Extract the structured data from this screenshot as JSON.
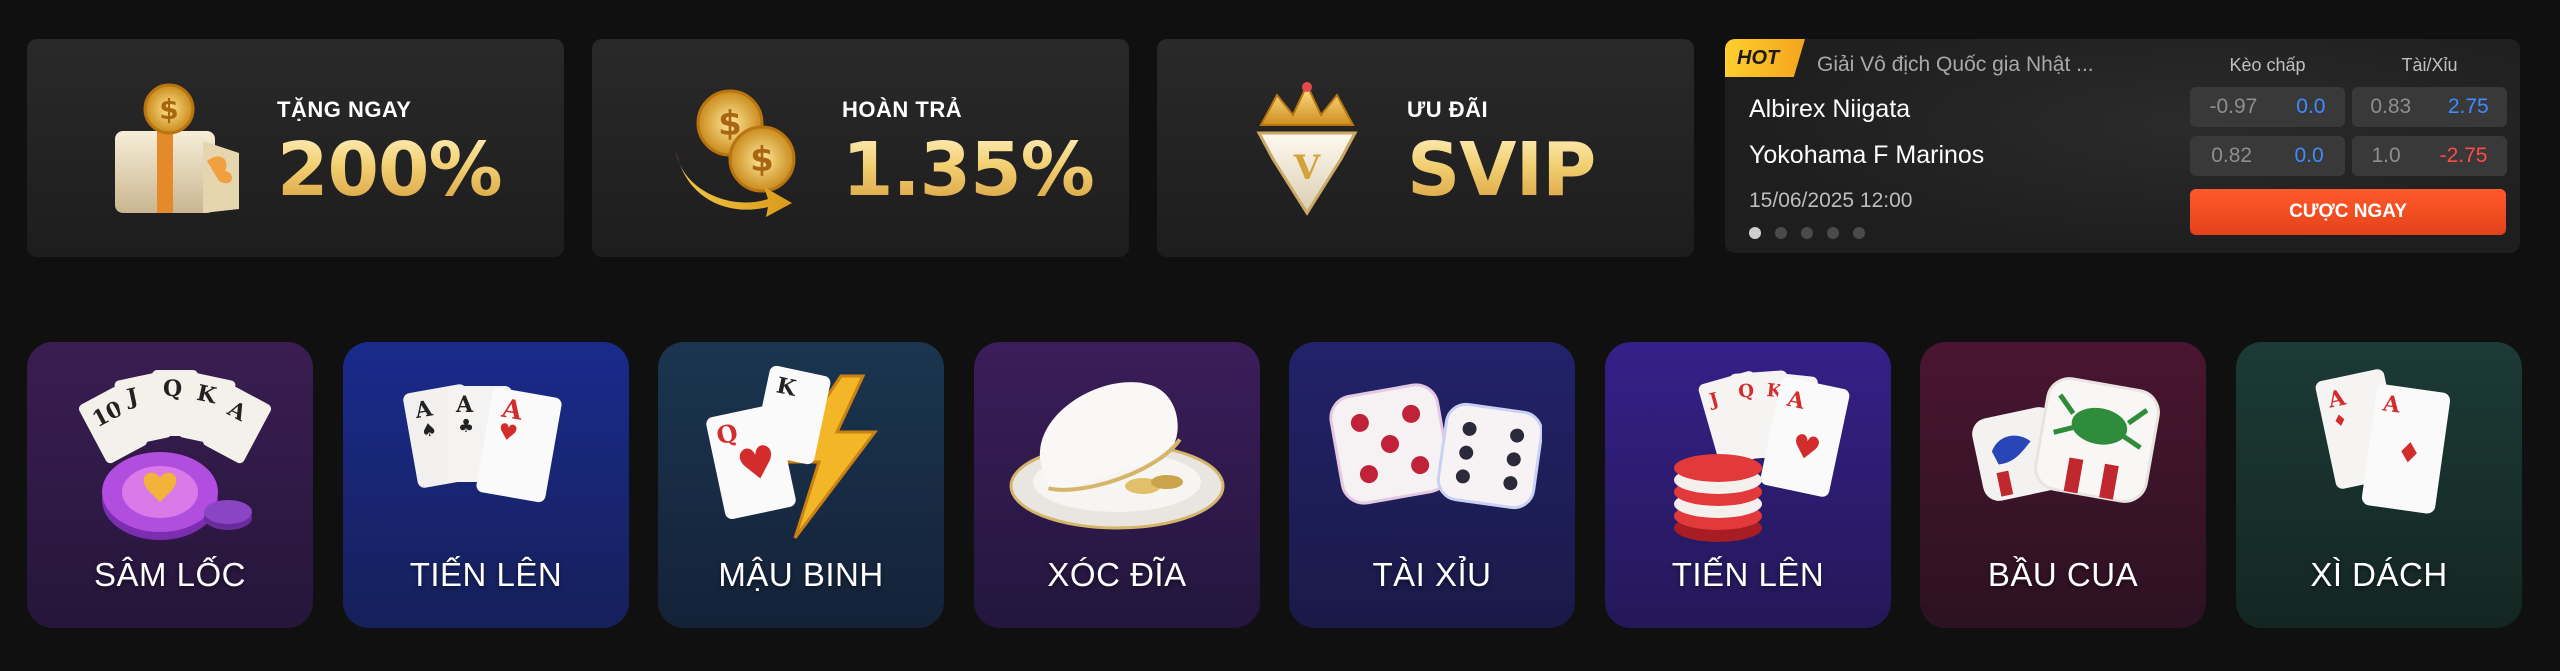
{
  "promos": [
    {
      "label": "TẶNG NGAY",
      "value": "200%"
    },
    {
      "label": "HOÀN TRẢ",
      "value": "1.35%"
    },
    {
      "label": "ƯU ĐÃI",
      "value": "SVIP"
    }
  ],
  "match": {
    "badge": "HOT",
    "league": "Giải Vô địch Quốc gia Nhật ...",
    "home": "Albirex Niigata",
    "away": "Yokohama F Marinos",
    "datetime": "15/06/2025 12:00",
    "handicap_header": "Kèo chấp",
    "overunder_header": "Tài/Xỉu",
    "odds": {
      "handicap_home": [
        "-0.97",
        "0.0"
      ],
      "handicap_away": [
        "0.82",
        "0.0"
      ],
      "ou_home": [
        "0.83",
        "2.75"
      ],
      "ou_away": [
        "1.0",
        "-2.75"
      ]
    },
    "bet_label": "CƯỢC NGAY",
    "carousel_count": 5,
    "carousel_active": 1
  },
  "games": [
    {
      "label": "SÂM LỐC",
      "icon": "poker-cards-chip-icon"
    },
    {
      "label": "TIẾN LÊN",
      "icon": "three-aces-icon"
    },
    {
      "label": "MẬU BINH",
      "icon": "queen-king-lightning-icon"
    },
    {
      "label": "XÓC ĐĨA",
      "icon": "bowl-plate-icon"
    },
    {
      "label": "TÀI XỈU",
      "icon": "dice-icon"
    },
    {
      "label": "TIẾN LÊN",
      "icon": "cards-chips-icon"
    },
    {
      "label": "BẦU CUA",
      "icon": "crab-dice-icon"
    },
    {
      "label": "XÌ DÁCH",
      "icon": "two-aces-icon"
    }
  ],
  "colors": {
    "background": "#111010",
    "gold": "#f2cf72",
    "bet_button": "#e9481e",
    "odds_blue": "#3d8bff",
    "odds_red": "#ff4a45"
  }
}
